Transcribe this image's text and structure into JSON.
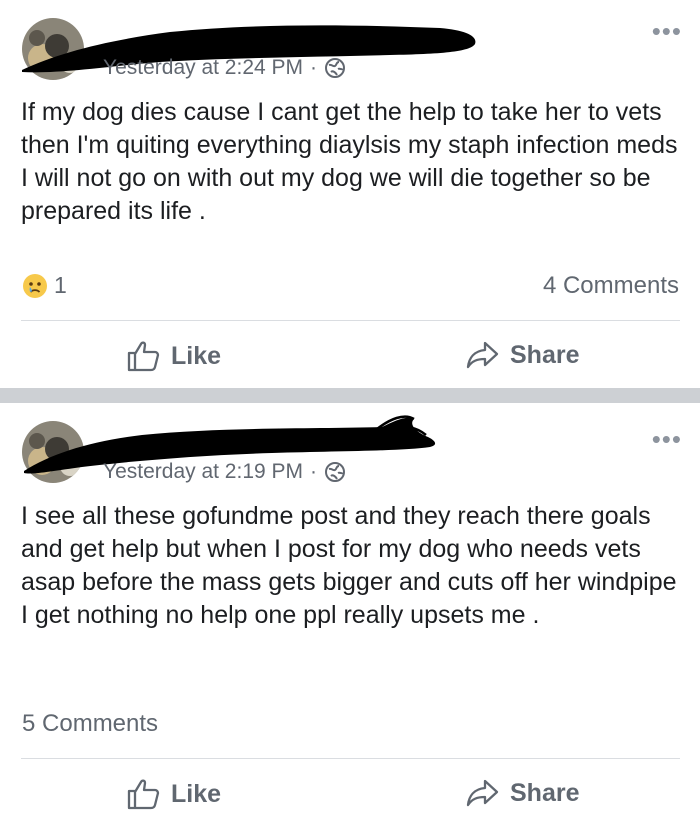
{
  "posts": [
    {
      "timestamp": "Yesterday at 2:24 PM",
      "separator": "·",
      "privacy_icon": "globe-icon",
      "text": "If my dog dies cause I cant get the help to take her to vets then I'm quiting everything diaylsis my staph infection meds I will not go on with out my dog we will die together so be prepared its life .",
      "reaction_icon": "sad-reaction-icon",
      "reaction_count": "1",
      "comments": "4 Comments",
      "like_label": "Like",
      "share_label": "Share"
    },
    {
      "timestamp": "Yesterday at 2:19 PM",
      "separator": "·",
      "privacy_icon": "globe-icon",
      "text": "I see all these gofundme post and they reach there goals and get help but when I post for my dog who needs vets asap before the mass gets bigger and cuts off her windpipe I get nothing no help one ppl really upsets me .",
      "comments": "5 Comments",
      "like_label": "Like",
      "share_label": "Share"
    }
  ],
  "more_icon": "ellipsis-icon",
  "colors": {
    "text": "#1c1e21",
    "meta": "#616770",
    "separator": "#cdd0d4",
    "redaction": "#000000"
  }
}
